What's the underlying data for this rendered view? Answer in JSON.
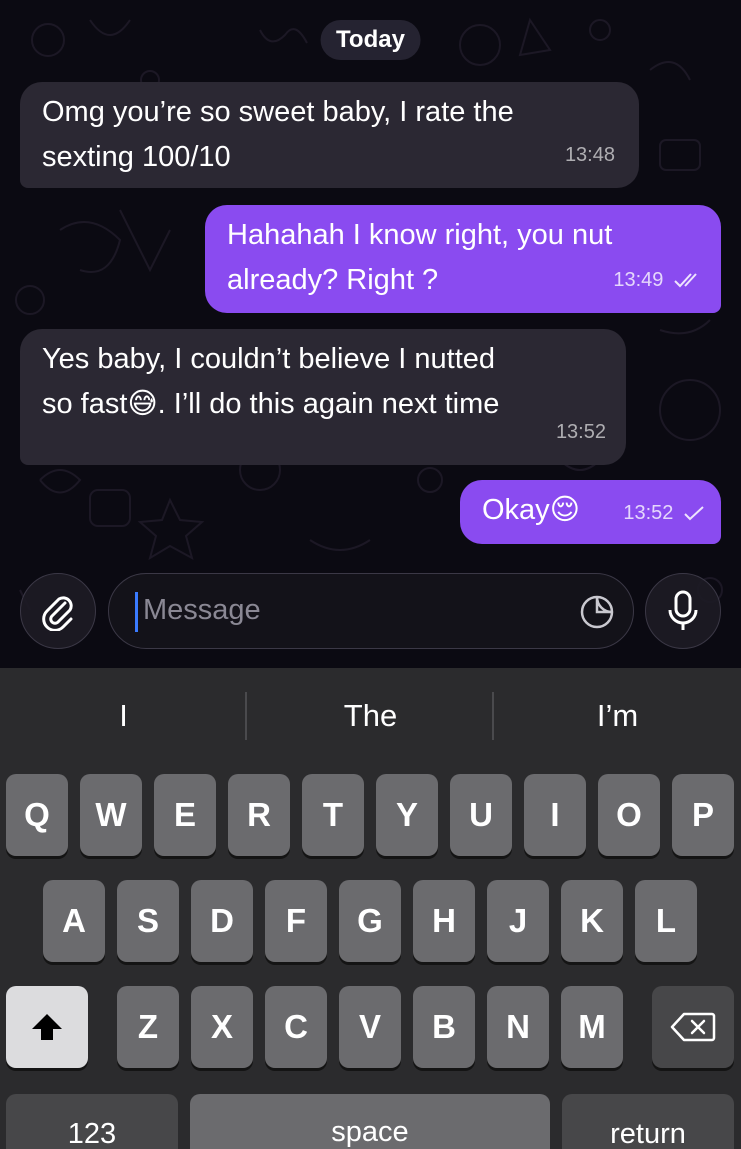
{
  "chat": {
    "date_label": "Today",
    "messages": [
      {
        "direction": "incoming",
        "lines": [
          "Omg you’re so sweet baby, I rate the",
          "sexting 100/10"
        ],
        "time": "13:48"
      },
      {
        "direction": "outgoing",
        "lines": [
          "Hahahah I know right, you nut",
          "already? Right ?"
        ],
        "time": "13:49",
        "status": "read"
      },
      {
        "direction": "incoming",
        "lines": [
          "Yes baby, I couldn’t believe I nutted",
          "so fast",
          ". I’ll do this again next time"
        ],
        "emoji": "😅",
        "time": "13:52"
      },
      {
        "direction": "outgoing",
        "lines": [
          "Okay"
        ],
        "emoji": "😌",
        "time": "13:52",
        "status": "sent"
      }
    ]
  },
  "input": {
    "placeholder": "Message",
    "attach_icon": "paperclip-icon",
    "sticker_icon": "sticker-icon",
    "mic_icon": "microphone-icon"
  },
  "keyboard": {
    "suggestions": [
      "I",
      "The",
      "I’m"
    ],
    "row1": [
      "Q",
      "W",
      "E",
      "R",
      "T",
      "Y",
      "U",
      "I",
      "O",
      "P"
    ],
    "row2": [
      "A",
      "S",
      "D",
      "F",
      "G",
      "H",
      "J",
      "K",
      "L"
    ],
    "row3": [
      "Z",
      "X",
      "C",
      "V",
      "B",
      "N",
      "M"
    ],
    "numbers_label": "123",
    "space_label": "space",
    "return_label": "return",
    "shift_icon": "shift-arrow-icon",
    "delete_icon": "backspace-icon"
  },
  "colors": {
    "incoming_bubble": "#2b2833",
    "outgoing_bubble": "#8a4bf0",
    "caret": "#3a7bff"
  }
}
